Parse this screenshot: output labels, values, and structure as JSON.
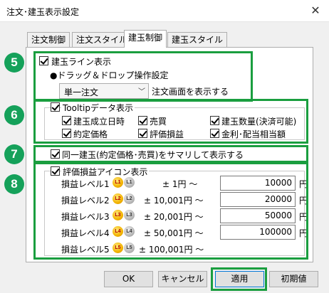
{
  "window": {
    "title": "注文･建玉表示設定"
  },
  "tabs": [
    {
      "label": "注文制御",
      "active": false
    },
    {
      "label": "注文スタイル",
      "active": false
    },
    {
      "label": "建玉制御",
      "active": true
    },
    {
      "label": "建玉スタイル",
      "active": false
    }
  ],
  "badges": [
    "5",
    "6",
    "7",
    "8"
  ],
  "line_section": {
    "checkbox_label": "建玉ライン表示",
    "drag_label": "●ドラッグ＆ドロップ操作設定",
    "select_value": "単一注文",
    "select_suffix": "注文画面を表示する"
  },
  "tooltip_section": {
    "group_label": "Tooltipデータ表示",
    "items": [
      "建玉成立日時",
      "売買",
      "建玉数量(決済可能)",
      "約定価格",
      "評価損益",
      "金利･配当相当額"
    ]
  },
  "summary_section": {
    "label": "同一建玉(約定価格･売買)をサマリして表示する"
  },
  "pnl_section": {
    "group_label": "評価損益アイコン表示",
    "levels": [
      {
        "name": "損益レベル1",
        "gold": "L1",
        "silver": "L1",
        "range": "± 1円 ～",
        "value": "10000",
        "unit": "円"
      },
      {
        "name": "損益レベル2",
        "gold": "L2",
        "silver": "L2",
        "range": "± 10,001円 ～",
        "value": "20000",
        "unit": "円"
      },
      {
        "name": "損益レベル3",
        "gold": "L3",
        "silver": "L3",
        "range": "± 20,001円 ～",
        "value": "50000",
        "unit": "円"
      },
      {
        "name": "損益レベル4",
        "gold": "L4",
        "silver": "L4",
        "range": "± 50,001円 ～",
        "value": "100000",
        "unit": "円"
      },
      {
        "name": "損益レベル5",
        "gold": "L5",
        "silver": "L5",
        "range": "± 100,001円 ～"
      }
    ]
  },
  "buttons": {
    "ok": "OK",
    "cancel": "キャンセル",
    "apply": "適用",
    "reset": "初期値"
  },
  "colors": {
    "annotation": "#1a9e3f",
    "badge": "#15a15a",
    "coin_gold": "#f2b300",
    "coin_silver": "#b9b9b9"
  },
  "icons": {
    "close": "close-icon",
    "dropdown": "chevron-down-icon",
    "gold_coin": "level-coin-gold-icon",
    "silver_coin": "level-coin-silver-icon"
  }
}
